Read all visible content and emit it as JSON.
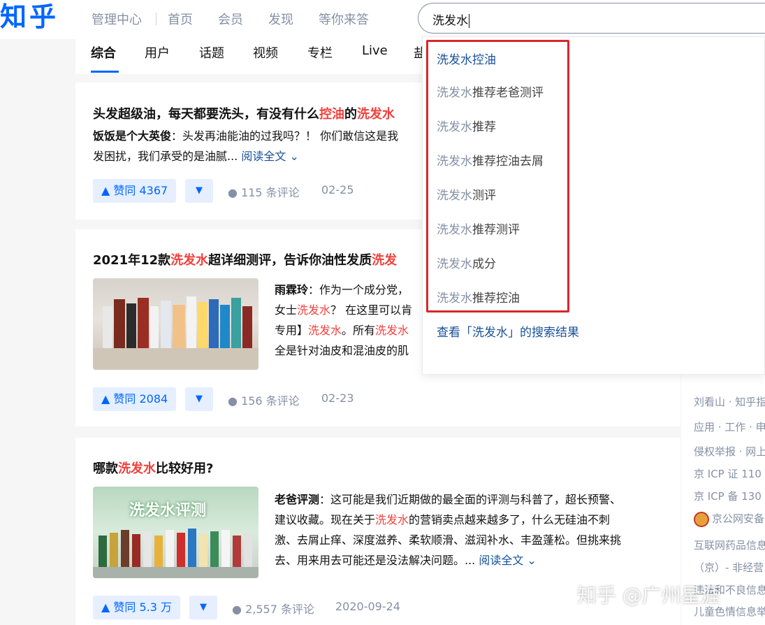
{
  "header": {
    "logo": "知乎",
    "nav": [
      "管理中心",
      "首页",
      "会员",
      "发现",
      "等你来答"
    ],
    "search_value": "洗发水"
  },
  "tabs": [
    "综合",
    "用户",
    "话题",
    "视频",
    "专栏",
    "Live",
    "盐"
  ],
  "results": [
    {
      "title_a": "头发超级油，每天都要洗头，有没有什么",
      "title_b": "控油",
      "title_c": "的",
      "title_d": "洗发水",
      "author": "饭饭是个大英俊",
      "excerpt_a": "：头发再油能油的过我吗？！ 你们敢信这是我",
      "excerpt_b": "发困扰，我们承受的是油腻... ",
      "read_more": "阅读全文 ⌄",
      "vote": "▲ 赞同 4367",
      "comments": "115 条评论",
      "date": "02-25"
    },
    {
      "title_a": "2021年12款",
      "title_b": "洗发水",
      "title_c": "超详细测评，告诉你油性发质",
      "title_d": "洗发",
      "author": "雨霖玲",
      "line1": "：作为一个成分党，",
      "line2_a": "女士",
      "line2_b": "洗发水",
      "line2_c": "？ 在这里可以肯",
      "line3_a": "专用】",
      "line3_b": "洗发水",
      "line3_c": "。所有",
      "line3_d": "洗发水",
      "line4": "全是针对油皮和混油皮的肌",
      "vote": "▲ 赞同 2084",
      "comments": "156 条评论",
      "date": "02-23"
    },
    {
      "title_a": "哪款",
      "title_b": "洗发水",
      "title_c": "比较好用?",
      "thumb_text": "洗发水评测",
      "author": "老爸评测",
      "line1": "：这可能是我们近期做的最全面的评测与科普了，超长预警、",
      "line2_a": "建议收藏。现在关于",
      "line2_b": "洗发水",
      "line2_c": "的营销卖点越来越多了，什么无硅油不刺",
      "line3": "激、去屑止痒、深度滋养、柔软顺滑、滋润补水、丰盈蓬松。但挑来挑",
      "line4": "去、用来用去可能还是没法解决问题。... ",
      "read_more": "阅读全文 ⌄",
      "vote": "▲ 赞同 5.3 万",
      "comments": "2,557 条评论",
      "date": "2020-09-24"
    }
  ],
  "dropdown": {
    "query": "洗发水",
    "suggestions": [
      {
        "rest": "控油"
      },
      {
        "rest": "推荐老爸测评"
      },
      {
        "rest": "推荐"
      },
      {
        "rest": "推荐控油去屑"
      },
      {
        "rest": "测评"
      },
      {
        "rest": "推荐测评"
      },
      {
        "rest": "成分"
      },
      {
        "rest": "推荐控油"
      }
    ],
    "view_all": "查看「洗发水」的搜索结果"
  },
  "sidebar": {
    "lines": [
      "刘看山 · 知乎指",
      "应用 · 工作 · 申",
      "侵权举报 · 网上",
      "京 ICP 证 110",
      "京 ICP 备 130",
      "京公网安备",
      "互联网药品信息",
      "（京）- 非经营",
      "违法和不良信息",
      "儿童色情信息举"
    ]
  },
  "watermark": "知乎 @广州星涯",
  "down_arrow": "▼",
  "comment_glyph": "💬"
}
